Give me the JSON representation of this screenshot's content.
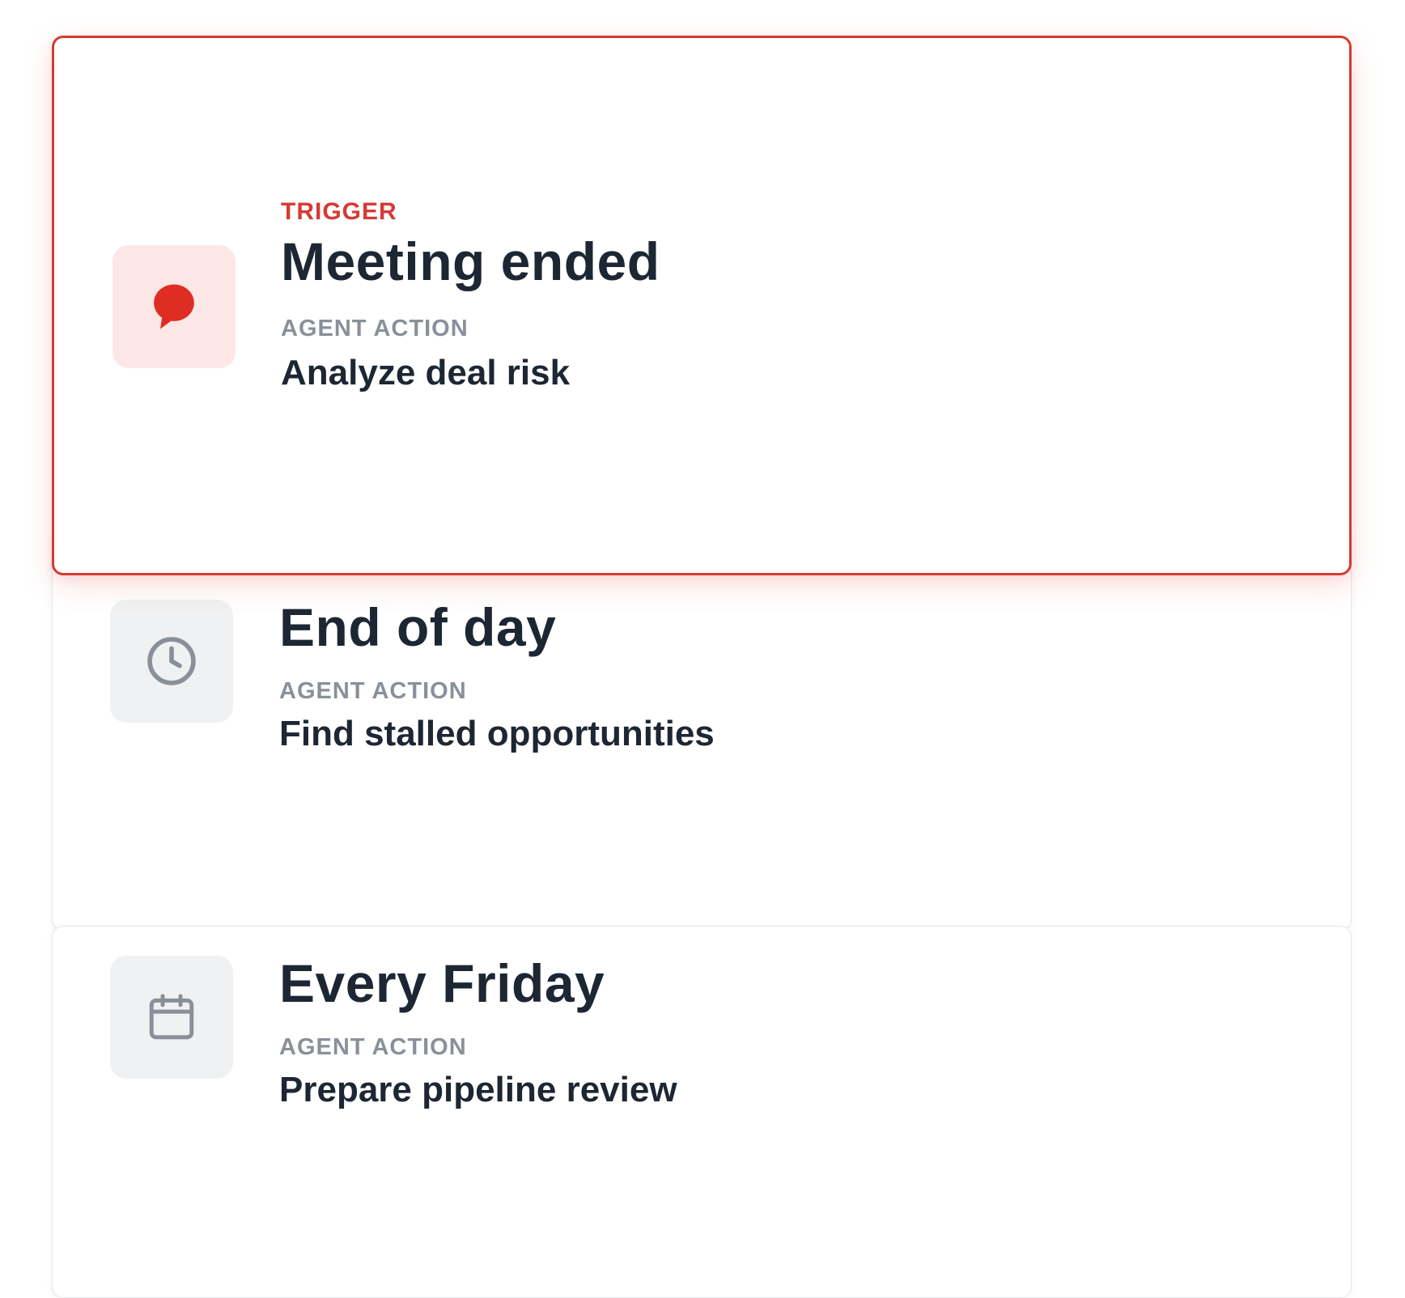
{
  "triggers": [
    {
      "label": "TRIGGER",
      "title": "Meeting ended",
      "action_label": "AGENT ACTION",
      "action": "Analyze deal risk",
      "icon": "chat-bubble-icon",
      "accent": "#d63a33"
    },
    {
      "title": "End of day",
      "action_label": "AGENT ACTION",
      "action": "Find stalled opportunities",
      "icon": "clock-icon"
    },
    {
      "title": "Every Friday",
      "action_label": "AGENT ACTION",
      "action": "Prepare pipeline review",
      "icon": "calendar-icon"
    }
  ]
}
